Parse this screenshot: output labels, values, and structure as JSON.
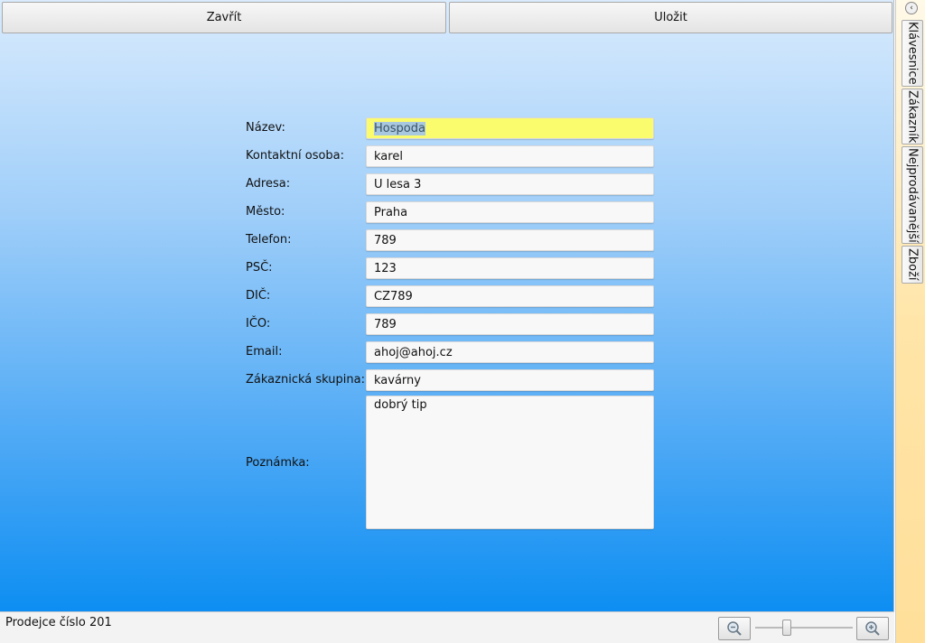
{
  "toolbar": {
    "close_label": "Zavřít",
    "save_label": "Uložit"
  },
  "form": {
    "fields": [
      {
        "label": "Název:",
        "value": "Hospoda"
      },
      {
        "label": "Kontaktní osoba:",
        "value": "karel"
      },
      {
        "label": "Adresa:",
        "value": "U lesa 3"
      },
      {
        "label": "Město:",
        "value": "Praha"
      },
      {
        "label": "Telefon:",
        "value": "789"
      },
      {
        "label": "PSČ:",
        "value": "123"
      },
      {
        "label": "DIČ:",
        "value": "CZ789"
      },
      {
        "label": "IČO:",
        "value": "789"
      },
      {
        "label": "Email:",
        "value": "ahoj@ahoj.cz"
      },
      {
        "label": "Zákaznická skupina:",
        "value": "kavárny"
      }
    ],
    "note": {
      "label": "Poznámka:",
      "value": "dobrý tip"
    }
  },
  "status": {
    "text": "Prodejce číslo 201",
    "zoom_level": 0.3
  },
  "side_panel": {
    "tabs": [
      {
        "label": "Klávesnice"
      },
      {
        "label": "Zákazník"
      },
      {
        "label": "Nejprodávanější"
      },
      {
        "label": "Zboží"
      }
    ]
  },
  "colors": {
    "highlight_field": "#fbfb6e",
    "accent": "#0d8ef2",
    "side_panel": "#ffdf9a"
  },
  "icons": {
    "zoom_out": "zoom-out-icon",
    "zoom_in": "zoom-in-icon",
    "collapse": "chevron-left-icon"
  }
}
